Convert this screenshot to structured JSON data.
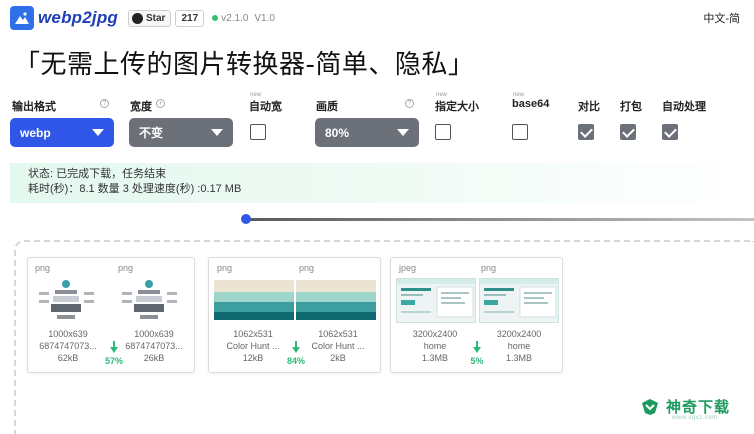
{
  "header": {
    "logo_text": "webp2jpg",
    "github_star_label": "Star",
    "github_star_count": "217",
    "version": "v2.1.0",
    "version_alt": "V1.0",
    "language": "中文-简"
  },
  "page_title": "「无需上传的图片转换器-简单、隐私」",
  "controls": {
    "output_format": {
      "label": "输出格式",
      "value": "webp"
    },
    "width": {
      "label": "宽度",
      "value": "不变"
    },
    "auto_width": {
      "label": "自动宽",
      "new_tag": "new",
      "checked": false
    },
    "quality": {
      "label": "画质",
      "value": "80%"
    },
    "fixed_size": {
      "label": "指定大小",
      "new_tag": "new",
      "checked": false
    },
    "base64": {
      "label": "base64",
      "new_tag": "new",
      "checked": false
    },
    "compare": {
      "label": "对比",
      "checked": true
    },
    "pack": {
      "label": "打包",
      "checked": true
    },
    "auto_process": {
      "label": "自动处理",
      "checked": true
    }
  },
  "status": {
    "line1": "状态: 已完成下载，任务结束",
    "line2": "耗时(秒)：8.1 数量 3 处理速度(秒) :0.17 MB"
  },
  "progress": {
    "value": 1.0
  },
  "files": [
    {
      "original": {
        "format": "png",
        "dimensions": "1000x639",
        "name": "6874747073...",
        "size": "62kB"
      },
      "converted": {
        "format": "png",
        "dimensions": "1000x639",
        "name": "6874747073...",
        "size": "26kB"
      },
      "saving": "57%"
    },
    {
      "original": {
        "format": "png",
        "dimensions": "1062x531",
        "name": "Color Hunt ...",
        "size": "12kB"
      },
      "converted": {
        "format": "png",
        "dimensions": "1062x531",
        "name": "Color Hunt ...",
        "size": "2kB"
      },
      "saving": "84%"
    },
    {
      "original": {
        "format": "jpeg",
        "dimensions": "3200x2400",
        "name": "home",
        "size": "1.3MB"
      },
      "converted": {
        "format": "png",
        "dimensions": "3200x2400",
        "name": "home",
        "size": "1.3MB"
      },
      "saving": "5%"
    }
  ],
  "watermark": {
    "brand": "神奇下载",
    "url": "www.sqxz.com"
  },
  "colors": {
    "accent": "#2f56e6",
    "select_gray": "#6b7079",
    "success": "#2fb87a"
  }
}
